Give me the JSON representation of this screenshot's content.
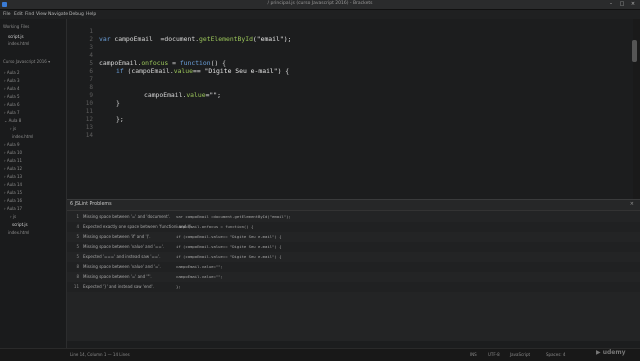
{
  "window": {
    "title": "/ principal.js (curso Javascript 2016) - Brackets",
    "controls": [
      "–",
      "□",
      "×"
    ]
  },
  "menu": [
    "File",
    "Edit",
    "Find",
    "View",
    "Navigate",
    "Debug",
    "Help"
  ],
  "sidebar": {
    "working_files_label": "Working Files",
    "working_files": [
      "script.js",
      "index.html"
    ],
    "project_label": "Curso Javascript 2016 ▾",
    "tree": [
      "› Aula 2",
      "› Aula 3",
      "› Aula 4",
      "› Aula 5",
      "› Aula 6",
      "› Aula 7",
      "⌄ Aula 8",
      "› js",
      "index.html",
      "› Aula 9",
      "› Aula 10",
      "› Aula 11",
      "› Aula 12",
      "› Aula 13",
      "› Aula 14",
      "› Aula 15",
      "› Aula 16",
      "› Aula 17",
      "› js",
      "script.js",
      "index.html"
    ]
  },
  "editor": {
    "line_numbers": [
      "1",
      "2",
      "3",
      "4",
      "5",
      "6",
      "7",
      "8",
      "9",
      "10",
      "11",
      "12",
      "13",
      "14"
    ],
    "lines": {
      "l2": {
        "kw": "var ",
        "a": "campoEmail  =document.",
        "fn": "getElementById",
        "b": "(\"email\");"
      },
      "l5": {
        "a": "campoEmail.",
        "fn": "onfocus",
        "b": " = ",
        "kw": "function",
        "c": "() {"
      },
      "l6": {
        "kw": "if ",
        "a": "(campoEmail.",
        "fn": "value",
        "b": "== \"Digite Seu e-mail\") {"
      },
      "l9": {
        "a": "campoEmail.",
        "fn": "value",
        "b": "=\"\";"
      },
      "l10": "}",
      "l12": "};"
    }
  },
  "jslint": {
    "title": "6 JSLint Problems",
    "close": "×",
    "problems": [
      {
        "line": "1",
        "message": "Missing space between '=' and 'document'.",
        "code": "var campoEmail =document.getElementById(\"email\");"
      },
      {
        "line": "4",
        "message": "Expected exactly one space between 'function' and '('.",
        "code": "campoEmail.onfocus = function() {"
      },
      {
        "line": "5",
        "message": "Missing space between 'if' and '('.",
        "code": "if (campoEmail.value== \"Digite Seu e-mail\") {"
      },
      {
        "line": "5",
        "message": "Missing space between 'value' and '=='.",
        "code": "if (campoEmail.value== \"Digite Seu e-mail\") {"
      },
      {
        "line": "5",
        "message": "Expected '===' and instead saw '=='.",
        "code": "if (campoEmail.value== \"Digite Seu e-mail\") {"
      },
      {
        "line": "8",
        "message": "Missing space between 'value' and '='.",
        "code": "campoEmail.value=\"\";"
      },
      {
        "line": "8",
        "message": "Missing space between '=' and '\"'.",
        "code": "campoEmail.value=\"\";"
      },
      {
        "line": "11",
        "message": "Expected '}' and instead saw 'end'.",
        "code": "};"
      }
    ]
  },
  "status": {
    "position": "Line 14, Column 1 — 14 Lines",
    "mode": "INS",
    "encoding": "UTF-8",
    "language": "JavaScript",
    "spaces": "Spaces: 4"
  },
  "watermark": "▶ udemy"
}
